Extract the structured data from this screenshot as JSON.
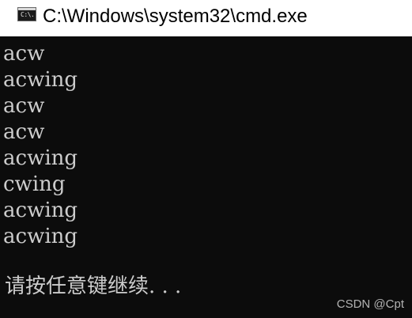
{
  "window": {
    "title": "C:\\Windows\\system32\\cmd.exe",
    "icon": "cmd-console-icon",
    "icon_glyph": "C:\\."
  },
  "console": {
    "output_lines": [
      "acw",
      "acwing",
      "acw",
      "acw",
      "acwing",
      "cwing",
      "acwing",
      "acwing"
    ],
    "prompt": "请按任意键继续. . ."
  },
  "watermark": "CSDN @Cpt",
  "colors": {
    "console_bg": "#0c0c0c",
    "console_text": "#cccccc",
    "titlebar_bg": "#ffffff"
  }
}
